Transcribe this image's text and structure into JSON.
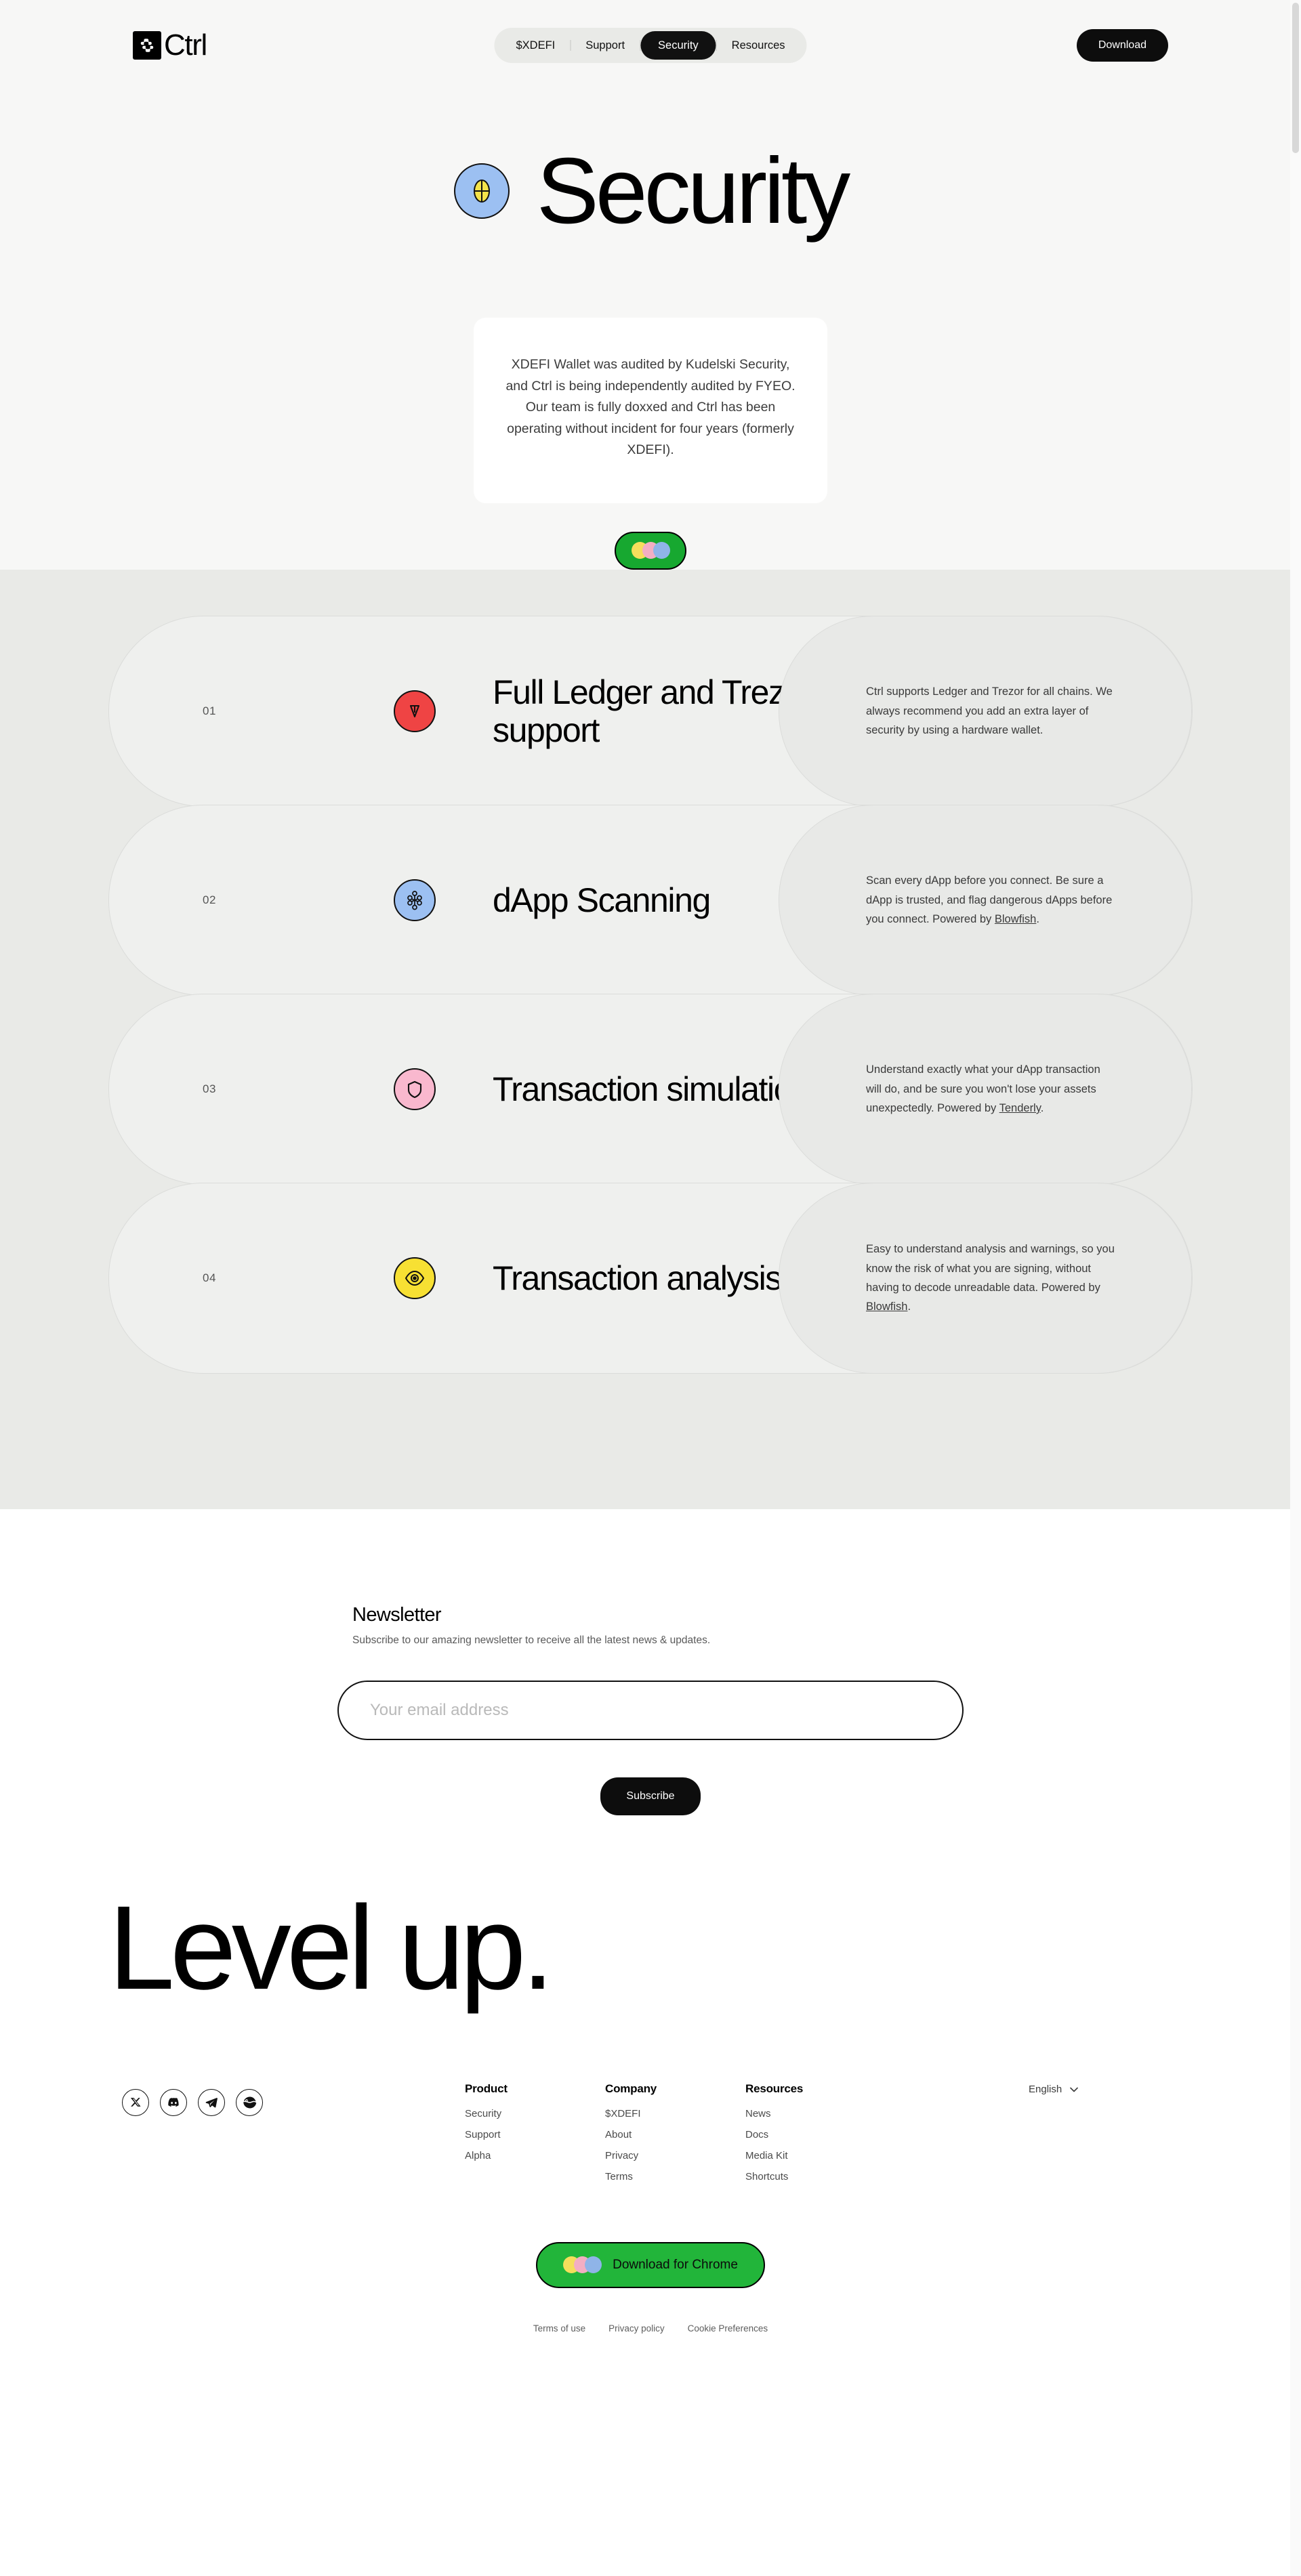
{
  "header": {
    "logo_text": "Ctrl",
    "logo_icon": "ctrl-pinwheel-logo",
    "nav": [
      {
        "label": "$XDEFI",
        "active": false
      },
      {
        "label": "Support",
        "active": false
      },
      {
        "label": "Security",
        "active": true
      },
      {
        "label": "Resources",
        "active": false
      }
    ],
    "download_label": "Download"
  },
  "hero": {
    "title": "Security",
    "badge_icon": "globe-badge-icon",
    "audit_text": "XDEFI Wallet was audited by Kudelski Security, and Ctrl is being independently audited by FYEO. Our team is fully doxxed and Ctrl has been operating without incident for four years (formerly XDEFI).",
    "chrome_pill_icon": "chrome-rings-icon"
  },
  "features": [
    {
      "number": "01",
      "title": "Full Ledger and Trezor support",
      "icon": "ledger-icon",
      "icon_color": "#ef4444",
      "desc_before": "Ctrl supports Ledger and Trezor for all chains. We always recommend you add an extra layer of security by using a hardware wallet.",
      "link_text": "",
      "desc_after": ""
    },
    {
      "number": "02",
      "title": "dApp Scanning",
      "icon": "molecule-icon",
      "icon_color": "#9cc0f2",
      "desc_before": "Scan every dApp before you connect. Be sure a dApp is trusted, and flag dangerous dApps before you connect. Powered by ",
      "link_text": "Blowfish",
      "desc_after": "."
    },
    {
      "number": "03",
      "title": "Transaction simulation",
      "icon": "shield-icon",
      "icon_color": "#f9b8ce",
      "desc_before": "Understand exactly what your dApp transaction will do, and be sure you won't lose your assets unexpectedly. Powered by ",
      "link_text": "Tenderly",
      "desc_after": "."
    },
    {
      "number": "04",
      "title": "Transaction analysis",
      "icon": "eye-icon",
      "icon_color": "#f7e033",
      "desc_before": "Easy to understand analysis and warnings, so you know the risk of what you are signing, without having to decode unreadable data. Powered by ",
      "link_text": "Blowfish",
      "desc_after": "."
    }
  ],
  "newsletter": {
    "title": "Newsletter",
    "subtitle": "Subscribe to our amazing newsletter to receive all the latest news & updates.",
    "email_placeholder": "Your email address",
    "email_value": "",
    "subscribe_label": "Subscribe"
  },
  "level_up": "Level up.",
  "footer": {
    "socials": [
      {
        "name": "x-twitter-icon"
      },
      {
        "name": "discord-icon"
      },
      {
        "name": "telegram-icon"
      },
      {
        "name": "coingecko-icon"
      }
    ],
    "columns": [
      {
        "heading": "Product",
        "links": [
          "Security",
          "Support",
          "Alpha"
        ]
      },
      {
        "heading": "Company",
        "links": [
          "$XDEFI",
          "About",
          "Privacy",
          "Terms"
        ]
      },
      {
        "heading": "Resources",
        "links": [
          "News",
          "Docs",
          "Media Kit",
          "Shortcuts"
        ]
      }
    ],
    "language": "English",
    "chrome_cta": "Download for Chrome",
    "legal": [
      "Terms of use",
      "Privacy policy",
      "Cookie Preferences"
    ]
  },
  "colors": {
    "accent_green": "#22b53a",
    "page_bg": "#f7f7f6",
    "band_bg": "#e9eae7",
    "card_bg": "#eff0ee"
  }
}
